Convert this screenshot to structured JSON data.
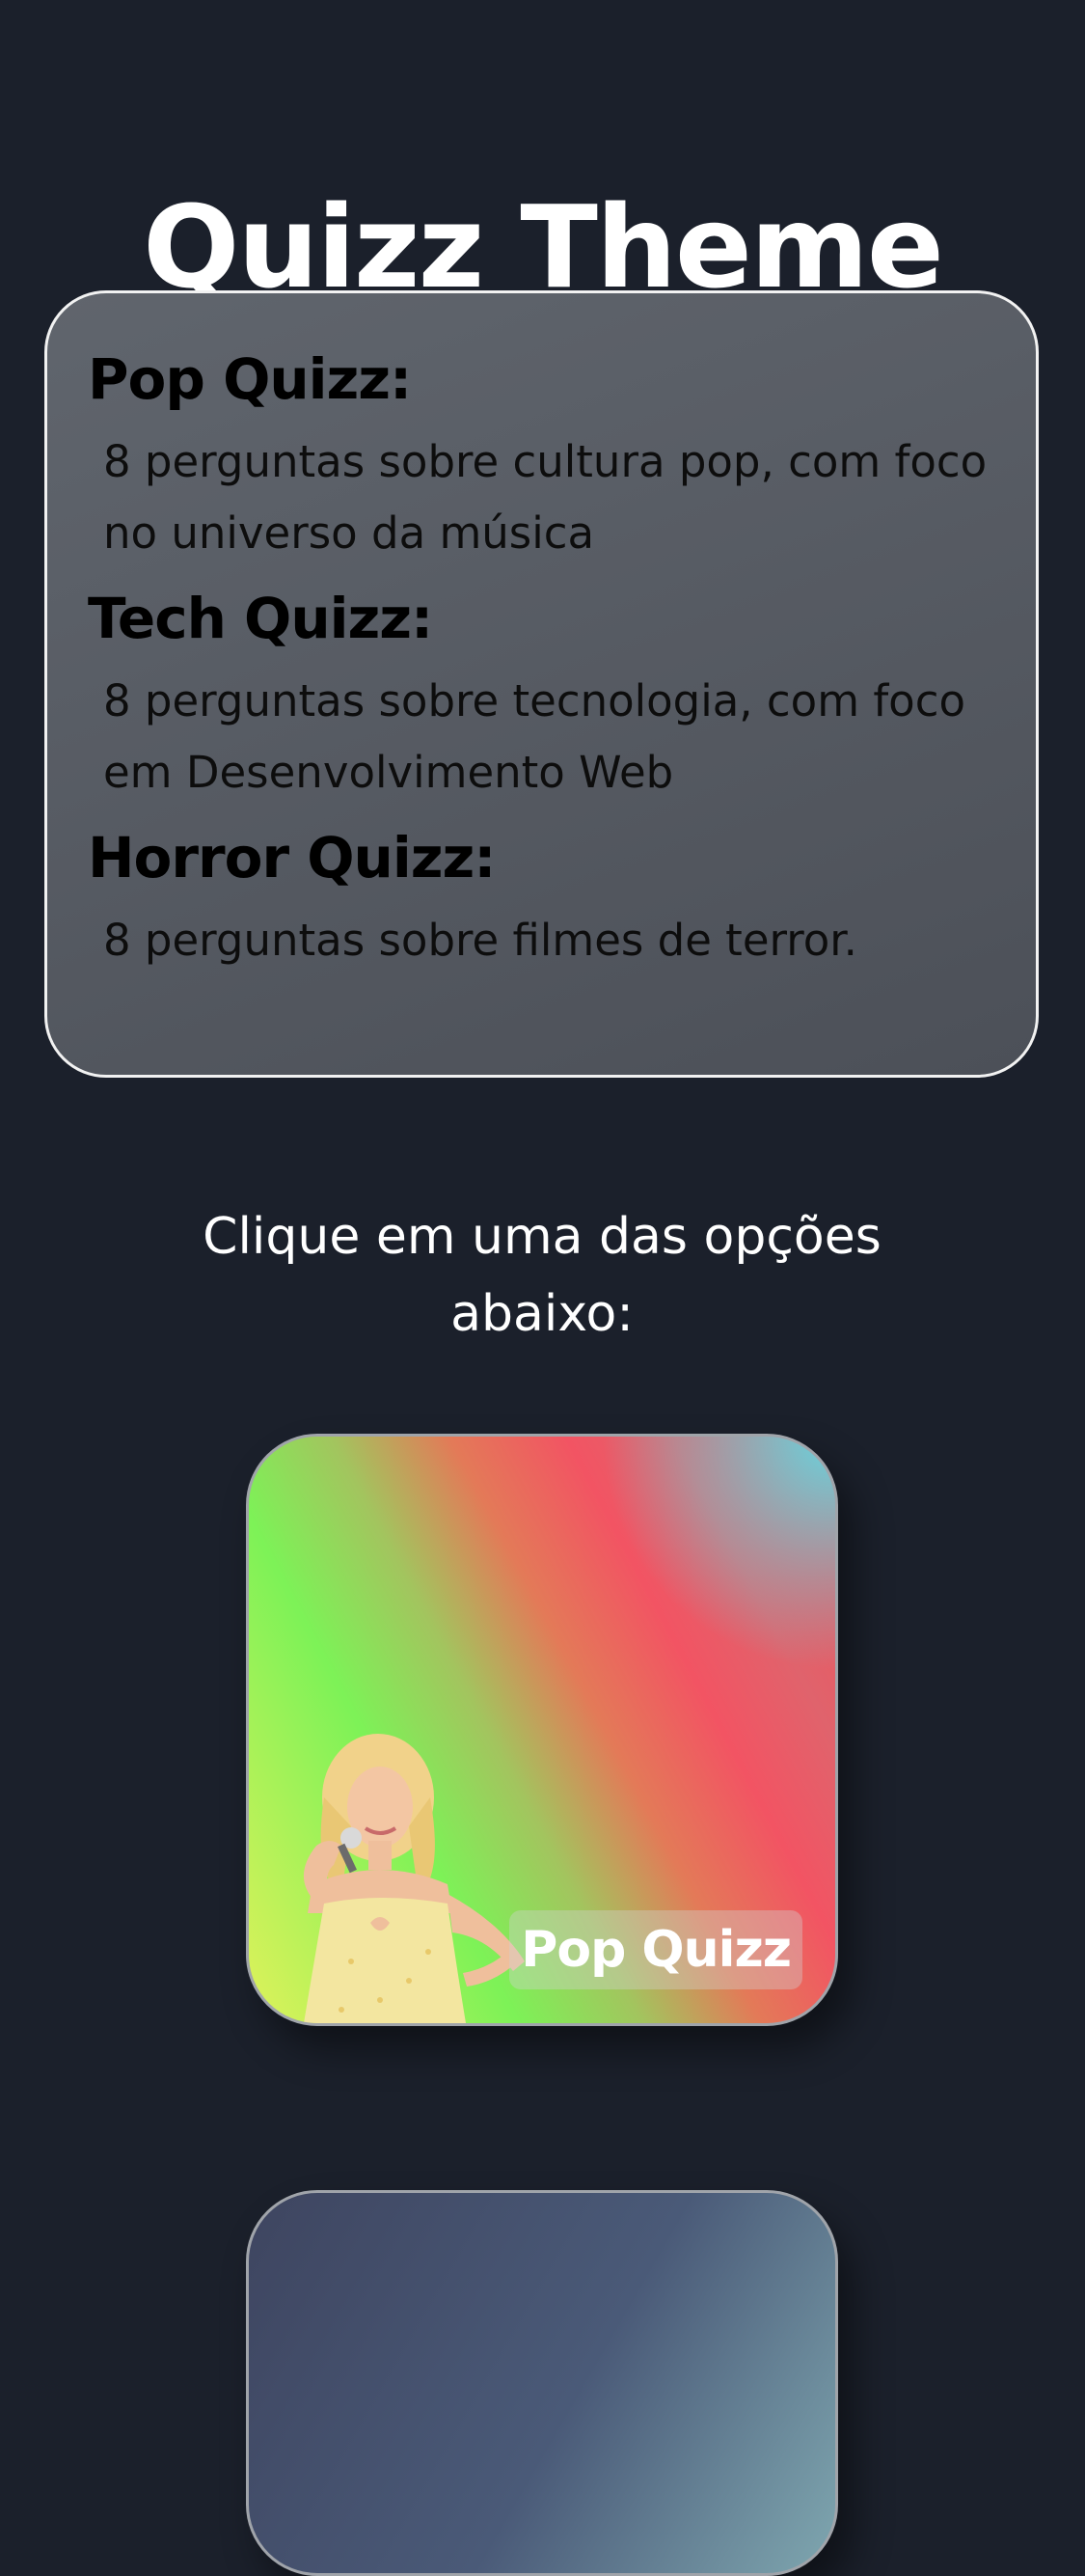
{
  "header": {
    "title": "Quizz Theme"
  },
  "info": {
    "quizzes": [
      {
        "name": "Pop Quizz:",
        "description": "8 perguntas sobre cultura pop, com foco no universo da música"
      },
      {
        "name": "Tech Quizz:",
        "description": "8 perguntas sobre tecnologia, com foco em Desenvolvimento Web"
      },
      {
        "name": "Horror Quizz:",
        "description": "8 perguntas sobre filmes de terror."
      }
    ]
  },
  "instruction": {
    "text": "Clique em uma das opções abaixo:"
  },
  "options": [
    {
      "label": "Pop Quizz",
      "icon": "pop-singer-image"
    },
    {
      "label": "",
      "icon": "tech-card-image"
    }
  ],
  "colors": {
    "background": "#1b202b",
    "card_border": "#f2f2f2",
    "pop_gradient_green": "#7df257",
    "pop_gradient_red": "#f25463",
    "pop_gradient_cyan": "#5fdce6"
  }
}
